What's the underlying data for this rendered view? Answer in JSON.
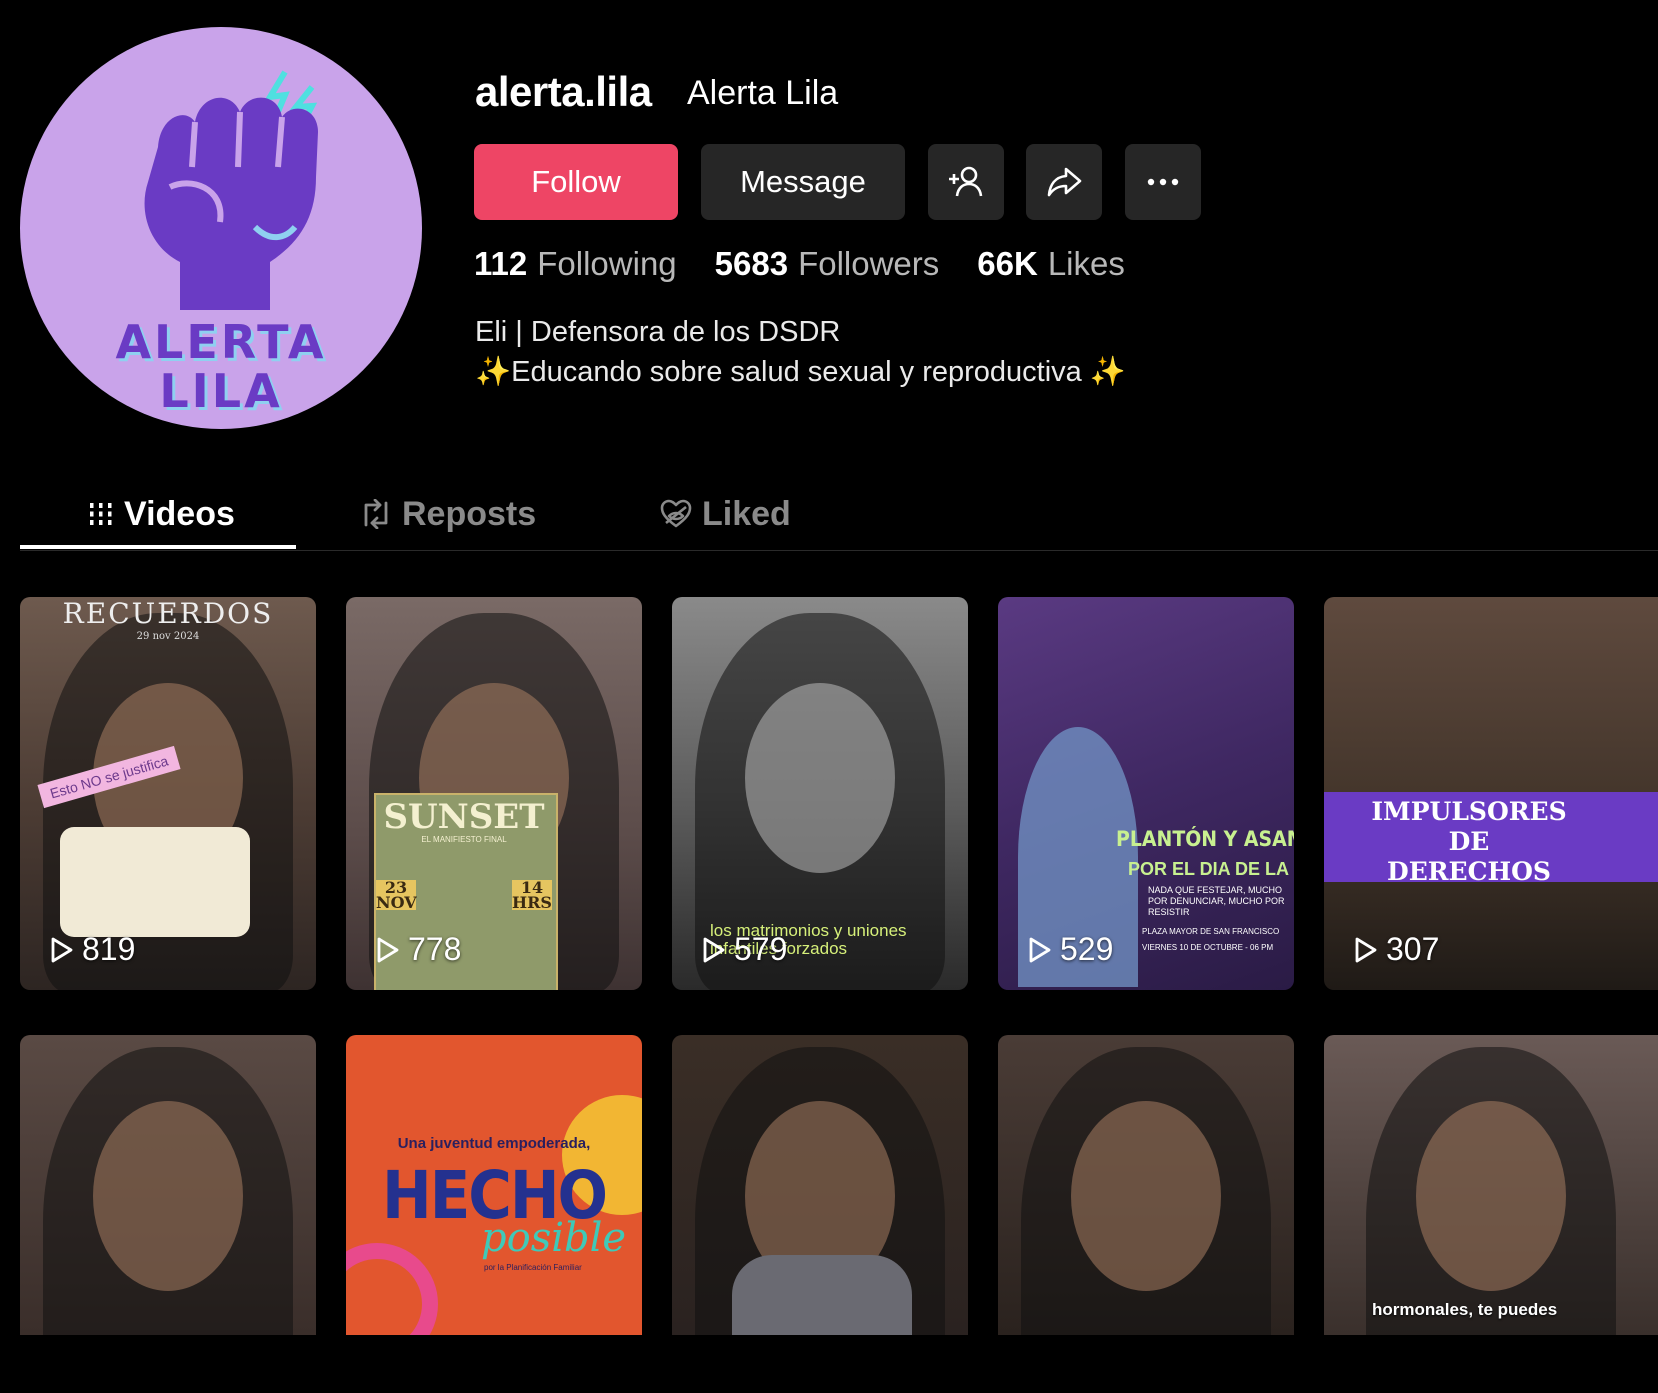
{
  "profile": {
    "username": "alerta.lila",
    "nickname": "Alerta Lila",
    "avatar_text_line1": "ALERTA",
    "avatar_text_line2": "LILA",
    "follow_label": "Follow",
    "message_label": "Message",
    "stats": {
      "following_count": "112",
      "following_label": "Following",
      "followers_count": "5683",
      "followers_label": "Followers",
      "likes_count": "66K",
      "likes_label": "Likes"
    },
    "bio_line1": "Eli | Defensora de los DSDR",
    "bio_line2": "✨Educando sobre salud sexual y reproductiva ✨"
  },
  "tabs": {
    "videos": "Videos",
    "reposts": "Reposts",
    "liked": "Liked"
  },
  "videos": [
    {
      "views": "819",
      "overlay_title": "RECUERDOS",
      "overlay_date": "29 nov 2024",
      "sticker": "Esto NO se justifica"
    },
    {
      "views": "778",
      "overlay_title": "SUNSET",
      "overlay_sub": "EL MANIFIESTO FINAL",
      "date_left": "23 NOV",
      "date_right": "14 HRS"
    },
    {
      "views": "579",
      "caption": "los matrimonios y uniones infantiles forzados"
    },
    {
      "views": "529",
      "title1": "PLANTÓN Y ASAMBLEA",
      "title2": "POR EL DIA DE LA MUJER",
      "sub": "NADA QUE FESTEJAR, MUCHO POR DENUNCIAR, MUCHO POR RESISTIR",
      "place": "PLAZA MAYOR DE SAN FRANCISCO",
      "when": "VIERNES 10 DE OCTUBRE - 06 PM"
    },
    {
      "views": "307",
      "title": "IMPULSORES DE DERECHOS"
    },
    {
      "views": ""
    },
    {
      "views": "",
      "line1": "Una juventud empoderada,",
      "line2": "HECHO",
      "line3": "posible",
      "line4": "por la Planificación Familiar"
    },
    {
      "views": ""
    },
    {
      "views": ""
    },
    {
      "views": "",
      "caption": "hormonales, te puedes"
    }
  ],
  "colors": {
    "accent": "#ee4565",
    "button_dark": "#262626",
    "avatar_bg": "#c9a3ea",
    "avatar_fist": "#6a3bc4"
  }
}
